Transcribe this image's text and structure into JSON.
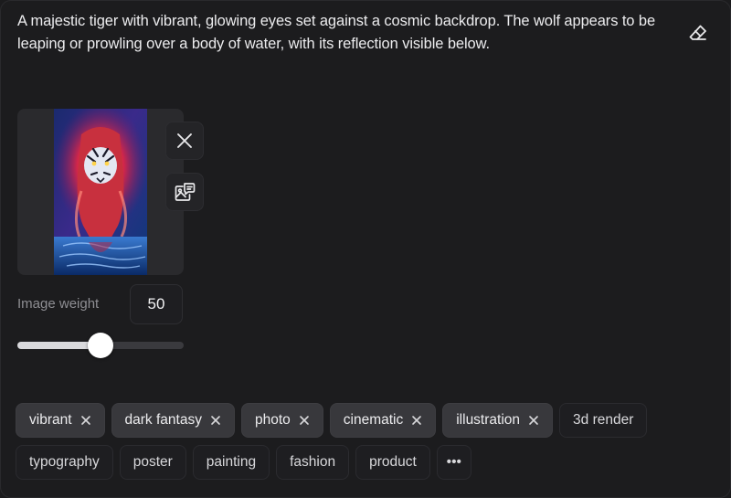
{
  "prompt": {
    "text": "A majestic tiger with vibrant, glowing eyes set against a cosmic backdrop. The wolf appears to be leaping or prowling over a body of water, with its reflection visible below."
  },
  "image_weight": {
    "label": "Image weight",
    "value": "50",
    "fraction": 0.5
  },
  "tags": [
    {
      "label": "vibrant",
      "selected": true
    },
    {
      "label": "dark fantasy",
      "selected": true
    },
    {
      "label": "photo",
      "selected": true
    },
    {
      "label": "cinematic",
      "selected": true
    },
    {
      "label": "illustration",
      "selected": true
    },
    {
      "label": "3d render",
      "selected": false
    },
    {
      "label": "typography",
      "selected": false
    },
    {
      "label": "poster",
      "selected": false
    },
    {
      "label": "painting",
      "selected": false
    },
    {
      "label": "fashion",
      "selected": false
    },
    {
      "label": "product",
      "selected": false
    }
  ],
  "more_label": "•••",
  "icons": {
    "clear": "eraser-icon",
    "remove_image": "close-icon",
    "describe_image": "image-chat-icon",
    "tag_remove": "close-icon"
  },
  "colors": {
    "background": "#1c1c1e",
    "selected_tag": "#38383c",
    "slider_fill": "#d9d9dc",
    "slider_track": "#3a3a3e"
  }
}
